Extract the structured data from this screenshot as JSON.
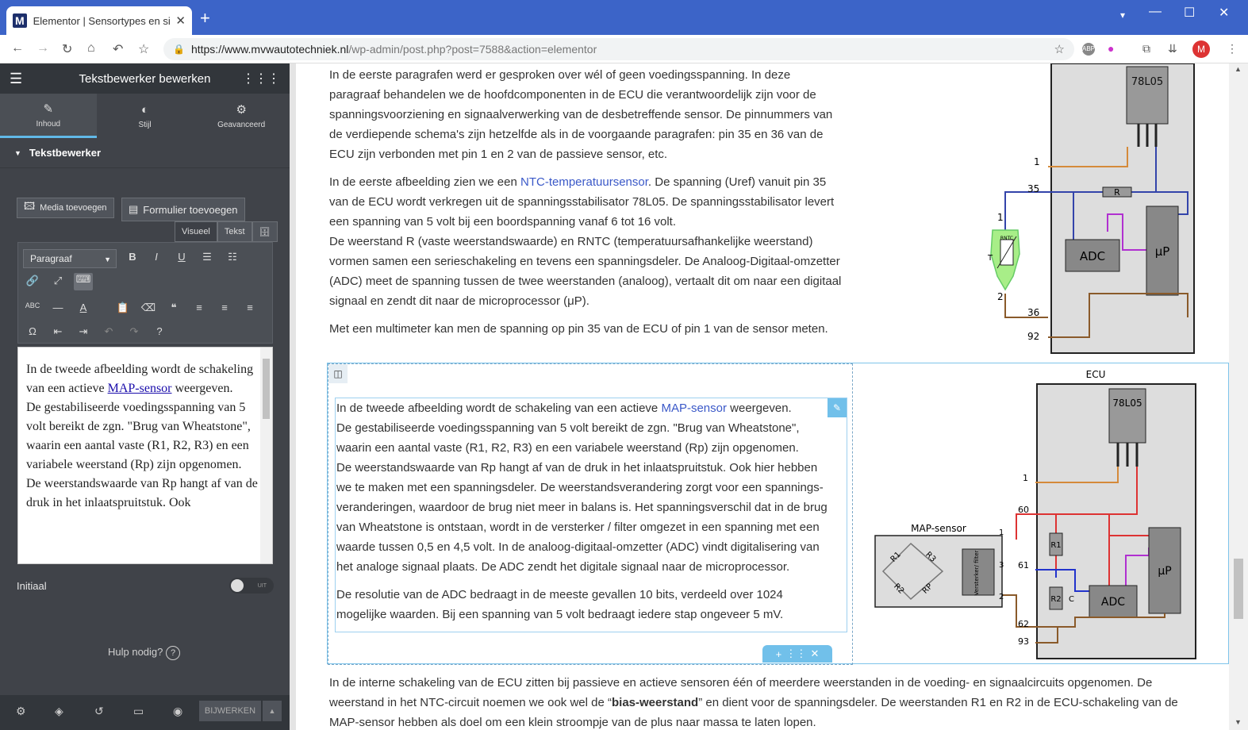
{
  "browser": {
    "tab_title": "Elementor | Sensortypes en signa",
    "url_host": "https://www.mvwautotechniek.nl",
    "url_path": "/wp-admin/post.php?post=7588&action=elementor",
    "avatar": "M",
    "abp": "ABP"
  },
  "panel": {
    "title": "Tekstbewerker bewerken",
    "tabs": [
      {
        "label": "Inhoud",
        "icon": "✎"
      },
      {
        "label": "Stijl",
        "icon": "◐"
      },
      {
        "label": "Geavanceerd",
        "icon": "⚙"
      }
    ],
    "section": "Tekstbewerker",
    "media_btn": "Media toevoegen",
    "form_btn": "Formulier toevoegen",
    "visual_tab": "Visueel",
    "text_tab": "Tekst",
    "format": "Paragraaf",
    "editor": {
      "l1": "In de tweede afbeelding wordt de schakeling van een actieve ",
      "link": "MAP-sensor",
      "l2": " weergeven.",
      "l3": "De gestabiliseerde voedingsspanning van 5 volt bereikt de zgn. \"Brug van Wheatstone\", waarin een aantal vaste (R1, R2, R3) en een variabele weerstand (Rp) zijn opgenomen.",
      "l4": "De weerstandswaarde van Rp hangt af van de druk in het inlaatspruitstuk. Ook"
    },
    "initial": "Initiaal",
    "toggle": "UIT",
    "help": "Hulp nodig?",
    "update": "BIJWERKEN"
  },
  "content": {
    "p1": "In de eerste paragrafen werd er gesproken over wél of geen voedingsspanning. In deze paragraaf behandelen we de hoofdcomponenten in de ECU die verantwoordelijk zijn voor de spanningsvoorziening en signaalverwerking van de desbetreffende sensor. De pinnummers van de verdiepende schema's zijn hetzelfde als in de voorgaande paragrafen: pin 35 en 36 van de ECU zijn verbonden met pin 1 en 2 van de passieve sensor, etc.",
    "p2a": "In de eerste afbeelding zien we een ",
    "p2link": "NTC-temperatuursensor",
    "p2b": ". De spanning (Uref) vanuit pin 35 van de ECU wordt verkregen uit de spanningsstabilisator 78L05. De spanningsstabilisator levert een spanning van 5 volt bij een boordspanning vanaf 6 tot 16 volt.",
    "p2c": "De weerstand R (vaste weerstandswaarde) en RNTC (temperatuursafhankelijke weerstand) vormen samen een serieschakeling en tevens een spanningsdeler. De Analoog-Digitaal-omzetter (ADC) meet de spanning tussen de twee weerstanden (analoog), vertaalt dit om naar een digitaal signaal en zendt dit naar de microprocessor (μP).",
    "p3": "Met een multimeter kan men de spanning op pin 35 van de ECU of pin 1 van de sensor meten.",
    "q1a": "In de tweede afbeelding wordt de schakeling van een actieve ",
    "q1link": "MAP-sensor",
    "q1b": " weergeven.",
    "q2": "De gestabiliseerde voedingsspanning van 5 volt bereikt de zgn. \"Brug van Wheatstone\", waarin een aantal vaste (R1, R2, R3) en een variabele weerstand (Rp) zijn opgenomen.",
    "q3": "De weerstandswaarde van Rp hangt af van de druk in het inlaatspruitstuk. Ook hier hebben we te maken met een spanningsdeler. De weerstandsverandering zorgt voor een spannings-veranderingen, waardoor de brug niet meer in balans is. Het spanningsverschil dat in de brug van Wheatstone is ontstaan, wordt in de versterker / filter omgezet in een spanning met een waarde tussen 0,5 en 4,5 volt. In de analoog-digitaal-omzetter (ADC) vindt digitalisering van het analoge signaal plaats. De ADC zendt het digitale signaal naar de microprocessor.",
    "q4": "De resolutie van de ADC bedraagt in de meeste gevallen 10 bits, verdeeld over 1024 mogelijke waarden. Bij een spanning van 5 volt bedraagt iedere stap ongeveer 5 mV.",
    "p5a": "In de interne schakeling van de ECU zitten bij passieve en actieve sensoren één of meerdere weerstanden in de voeding- en signaalcircuits opgenomen. De weerstand in het NTC-circuit noemen we ook wel de “",
    "p5bold": "bias-weerstand",
    "p5b": "” en dient voor de spanningsdeler. De weerstanden R1 en R2 in de ECU-schakeling van de MAP-sensor hebben als doel om een klein stroompje van de plus naar massa te laten lopen.",
    "d1": {
      "reg": "78L05",
      "r": "R",
      "adc": "ADC",
      "up": "μP",
      "rntc": "RNTC",
      "t": "T",
      "pins": [
        "1",
        "35",
        "36",
        "92"
      ],
      "spins": [
        "1",
        "2"
      ]
    },
    "d2": {
      "ecu": "ECU",
      "reg": "78L05",
      "map": "MAP-sensor",
      "r1": "R1",
      "r2": "R2",
      "r3": "R3",
      "rp": "RP",
      "amp": "Versterker/ filter",
      "er1": "R1",
      "er2": "R2",
      "c": "C",
      "adc": "ADC",
      "up": "μP",
      "pins": [
        "1",
        "60",
        "61",
        "62",
        "93"
      ],
      "spins": [
        "1",
        "3",
        "2"
      ]
    }
  }
}
